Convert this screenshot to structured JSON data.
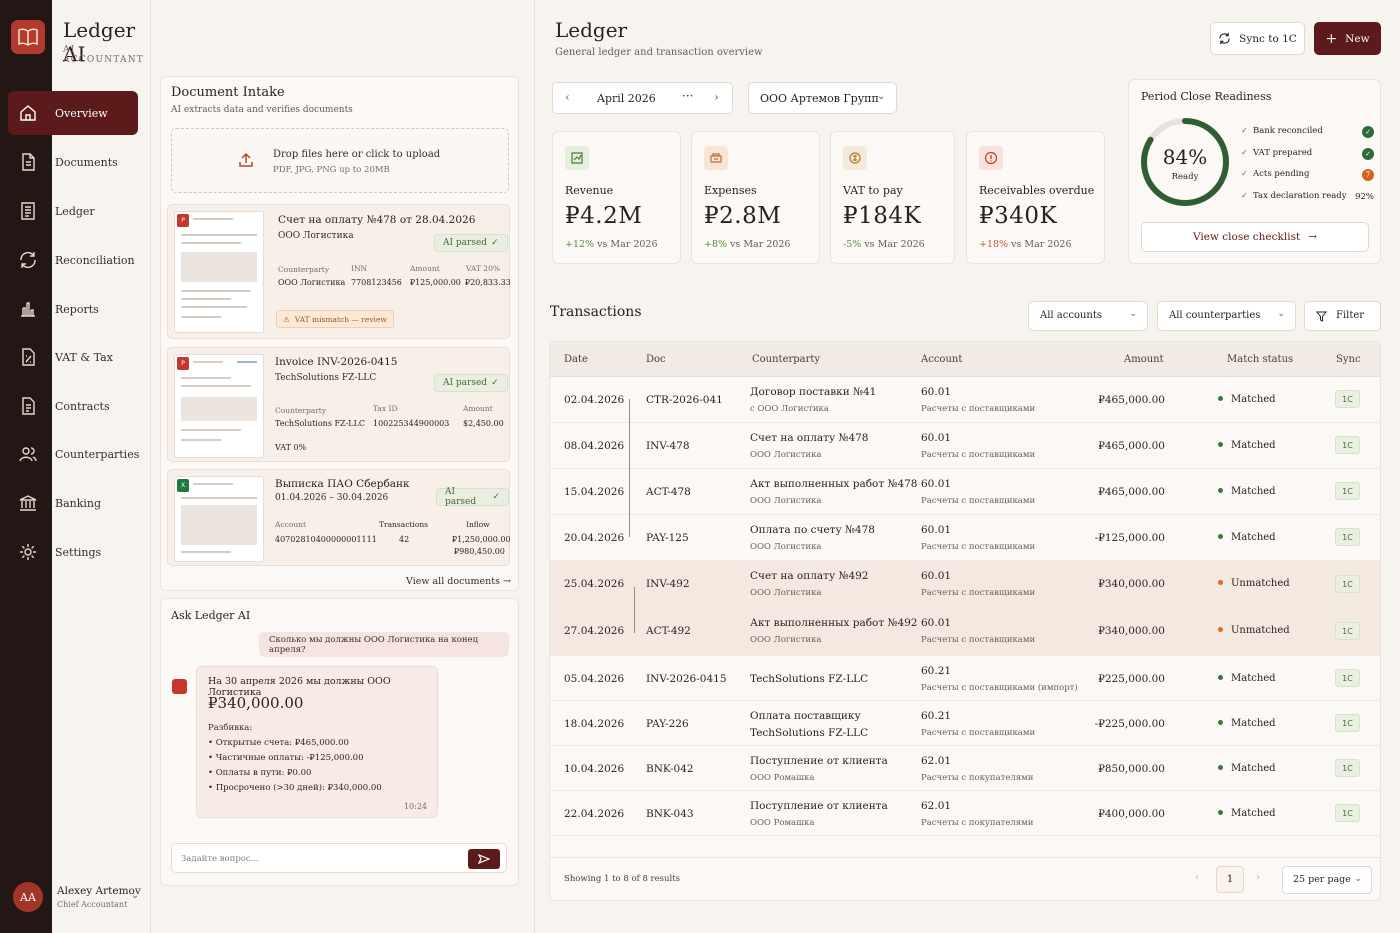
{
  "brand": {
    "title": "Ledger AI",
    "subtitle": "AI ACCOUNTANT"
  },
  "nav": [
    {
      "label": "Overview",
      "icon": "home-icon",
      "active": true
    },
    {
      "label": "Documents",
      "icon": "document-icon"
    },
    {
      "label": "Ledger",
      "icon": "ledger-icon"
    },
    {
      "label": "Reconciliation",
      "icon": "sync-icon"
    },
    {
      "label": "Reports",
      "icon": "reports-icon"
    },
    {
      "label": "VAT & Tax",
      "icon": "tax-icon"
    },
    {
      "label": "Contracts",
      "icon": "contract-icon"
    },
    {
      "label": "Counterparties",
      "icon": "people-icon"
    },
    {
      "label": "Banking",
      "icon": "bank-icon"
    },
    {
      "label": "Settings",
      "icon": "gear-icon"
    }
  ],
  "user": {
    "initials": "AA",
    "name": "Alexey Artemov",
    "role": "Chief Accountant"
  },
  "intake": {
    "title": "Document Intake",
    "subtitle": "AI extracts data and verifies documents",
    "drop_title": "Drop files here or click to upload",
    "drop_sub": "PDF, JPG, PNG up to 20MB",
    "docs": [
      {
        "title": "Счет на оплату №478 от 28.04.2026",
        "sub": "ООО Логистика",
        "status": "AI parsed",
        "fields": [
          {
            "label": "Counterparty",
            "value": "ООО Логистика"
          },
          {
            "label": "INN",
            "value": "7708123456"
          },
          {
            "label": "Amount",
            "value": "₽125,000.00"
          },
          {
            "label": "VAT 20%",
            "value": "₽20,833.33"
          }
        ],
        "warning": "VAT mismatch — review"
      },
      {
        "title": "Invoice INV-2026-0415",
        "sub": "TechSolutions FZ-LLC",
        "status": "AI parsed",
        "fields": [
          {
            "label": "Counterparty",
            "value": "TechSolutions FZ-LLC"
          },
          {
            "label": "Tax ID",
            "value": "100225344900003"
          },
          {
            "label": "Amount",
            "value": "$2,450.00"
          }
        ],
        "extra": "VAT 0%"
      },
      {
        "title": "Выписка ПАО Сбербанк",
        "sub": "01.04.2026 – 30.04.2026",
        "status": "AI parsed",
        "fields": [
          {
            "label": "Account",
            "value": "40702810400000001111"
          },
          {
            "label": "Transactions",
            "value": "42"
          },
          {
            "label": "Inflow",
            "value": "₽1,250,000.00"
          }
        ],
        "outflow": "₽980,450.00"
      }
    ],
    "view_all": "View all documents"
  },
  "ask": {
    "title": "Ask Ledger AI",
    "user_msg": "Сколько мы должны ООО Логистика на конец апреля?",
    "answer_q": "На 30 апреля 2026 мы должны ООО Логистика",
    "answer_amount": "₽340,000.00",
    "breakdown_label": "Разбивка:",
    "breakdown": [
      "Открытые счета: ₽465,000.00",
      "Частичные оплаты: -₽125,000.00",
      "Оплаты в пути: ₽0.00",
      "Просрочено (>30 дней): ₽340,000.00"
    ],
    "time": "10:24",
    "placeholder": "Задайте вопрос..."
  },
  "header": {
    "title": "Ledger",
    "subtitle": "General ledger and transaction overview",
    "sync_label": "Sync to 1C",
    "new_label": "New"
  },
  "period": "April 2026",
  "company": "ООО Артемов Групп",
  "kpis": [
    {
      "label": "Revenue",
      "value": "₽4.2M",
      "delta": "+12%",
      "compare": "vs Mar 2026",
      "dir": "pos",
      "icon": "revenue-icon",
      "bg": "#e6efdd",
      "fg": "#4a7a3a"
    },
    {
      "label": "Expenses",
      "value": "₽2.8M",
      "delta": "+8%",
      "compare": "vs Mar 2026",
      "dir": "pos",
      "icon": "expenses-icon",
      "bg": "#f7e6d6",
      "fg": "#c26a2a"
    },
    {
      "label": "VAT to pay",
      "value": "₽184K",
      "delta": "-5%",
      "compare": "vs Mar 2026",
      "dir": "pos",
      "icon": "vat-icon",
      "bg": "#f5ead8",
      "fg": "#b0782a"
    },
    {
      "label": "Receivables overdue",
      "value": "₽340K",
      "delta": "+18%",
      "compare": "vs Mar 2026",
      "dir": "neg",
      "icon": "alert-icon",
      "bg": "#f6e2de",
      "fg": "#c2402e"
    }
  ],
  "readiness": {
    "title": "Period Close Readiness",
    "percent": "84%",
    "percent_value": 84,
    "ready_label": "Ready",
    "items": [
      {
        "label": "Bank reconciled",
        "status": "ok",
        "text": "✓"
      },
      {
        "label": "VAT prepared",
        "status": "ok",
        "text": "✓"
      },
      {
        "label": "Acts pending",
        "status": "warn",
        "text": "7"
      },
      {
        "label": "Tax declaration ready",
        "status": "txt",
        "text": "92%"
      }
    ],
    "button": "View close checklist"
  },
  "transactions": {
    "title": "Transactions",
    "filter_accounts": "All accounts",
    "filter_counterparties": "All counterparties",
    "filter_label": "Filter",
    "columns": [
      "Date",
      "Doc",
      "Counterparty",
      "Account",
      "Amount",
      "Match status",
      "Sync"
    ],
    "rows": [
      {
        "date": "02.04.2026",
        "doc": "CTR-2026-041",
        "cp": "Договор поставки №41",
        "cp_sub": "с ООО Логистика",
        "acc": "60.01",
        "acc_sub": "Расчеты с поставщиками",
        "amount": "₽465,000.00",
        "status": "Matched",
        "sync": "1C"
      },
      {
        "date": "08.04.2026",
        "doc": "INV-478",
        "cp": "Счет на оплату №478",
        "cp_sub": "ООО Логистика",
        "acc": "60.01",
        "acc_sub": "Расчеты с поставщиками",
        "amount": "₽465,000.00",
        "status": "Matched",
        "sync": "1C"
      },
      {
        "date": "15.04.2026",
        "doc": "ACT-478",
        "cp": "Акт выполненных работ №478",
        "cp_sub": "ООО Логистика",
        "acc": "60.01",
        "acc_sub": "Расчеты с поставщиками",
        "amount": "₽465,000.00",
        "status": "Matched",
        "sync": "1C"
      },
      {
        "date": "20.04.2026",
        "doc": "PAY-125",
        "cp": "Оплата по счету №478",
        "cp_sub": "ООО Логистика",
        "acc": "60.01",
        "acc_sub": "Расчеты с поставщиками",
        "amount": "-₽125,000.00",
        "status": "Matched",
        "sync": "1C"
      },
      {
        "date": "25.04.2026",
        "doc": "INV-492",
        "cp": "Счет на оплату №492",
        "cp_sub": "ООО Логистика",
        "acc": "60.01",
        "acc_sub": "Расчеты с поставщиками",
        "amount": "₽340,000.00",
        "status": "Unmatched",
        "sync": "1C"
      },
      {
        "date": "27.04.2026",
        "doc": "ACT-492",
        "cp": "Акт выполненных работ №492",
        "cp_sub": "ООО Логистика",
        "acc": "60.01",
        "acc_sub": "Расчеты с поставщиками",
        "amount": "₽340,000.00",
        "status": "Unmatched",
        "sync": "1C"
      },
      {
        "date": "05.04.2026",
        "doc": "INV-2026-0415",
        "cp": "TechSolutions FZ-LLC",
        "cp_sub": "",
        "acc": "60.21",
        "acc_sub": "Расчеты с поставщиками (импорт)",
        "amount": "₽225,000.00",
        "status": "Matched",
        "sync": "1C"
      },
      {
        "date": "18.04.2026",
        "doc": "PAY-226",
        "cp": "Оплата поставщику",
        "cp_sub": "TechSolutions FZ-LLC",
        "acc": "60.21",
        "acc_sub": "Расчеты с поставщиками",
        "amount": "-₽225,000.00",
        "status": "Matched",
        "sync": "1C"
      },
      {
        "date": "10.04.2026",
        "doc": "BNK-042",
        "cp": "Поступление от клиента",
        "cp_sub": "ООО Ромашка",
        "acc": "62.01",
        "acc_sub": "Расчеты с покупателями",
        "amount": "₽850,000.00",
        "status": "Matched",
        "sync": "1C"
      },
      {
        "date": "22.04.2026",
        "doc": "BNK-043",
        "cp": "Поступление от клиента",
        "cp_sub": "ООО Ромашка",
        "acc": "62.01",
        "acc_sub": "Расчеты с покупателями",
        "amount": "₽400,000.00",
        "status": "Matched",
        "sync": "1C"
      }
    ],
    "showing": "Showing 1 to 8 of 8 results",
    "page": "1",
    "per_page": "25 per page"
  }
}
